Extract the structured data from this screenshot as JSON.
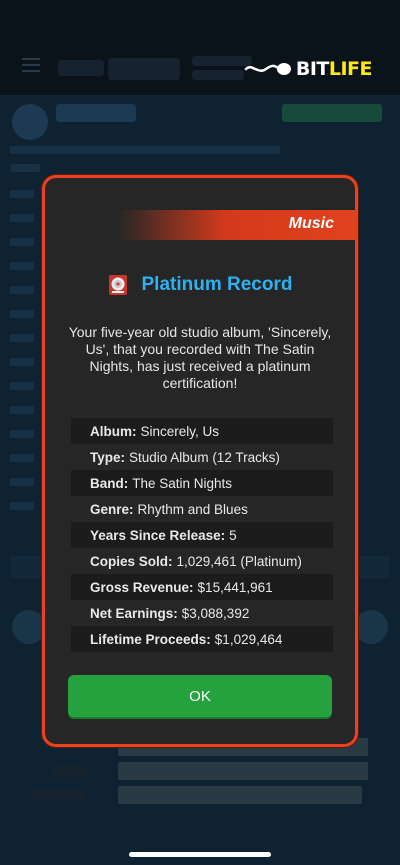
{
  "app": {
    "logo_bit": "BIT",
    "logo_life": "LIFE"
  },
  "background": {
    "brand_color": "#e84220"
  },
  "modal": {
    "category": "Music",
    "title": "Platinum Record",
    "title_icon": "record-icon",
    "message": "Your five-year old studio album, 'Sincerely, Us', that you recorded with The Satin Nights, has just received a platinum certification!",
    "details": [
      {
        "label": "Album:",
        "value": "Sincerely, Us"
      },
      {
        "label": "Type:",
        "value": "Studio Album (12 Tracks)"
      },
      {
        "label": "Band:",
        "value": "The Satin Nights"
      },
      {
        "label": "Genre:",
        "value": "Rhythm and Blues"
      },
      {
        "label": "Years Since Release:",
        "value": "5"
      },
      {
        "label": "Copies Sold:",
        "value": "1,029,461 (Platinum)"
      },
      {
        "label": "Gross Revenue:",
        "value": "$15,441,961"
      },
      {
        "label": "Net Earnings:",
        "value": "$3,088,392"
      },
      {
        "label": "Lifetime Proceeds:",
        "value": "$1,029,464"
      }
    ],
    "ok_label": "OK",
    "colors": {
      "border": "#e84220",
      "title": "#2fb0f0",
      "ok_button": "#25a13e"
    }
  }
}
